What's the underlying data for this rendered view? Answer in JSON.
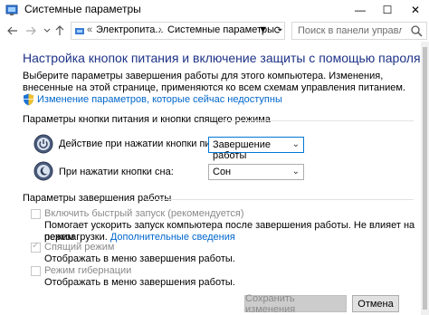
{
  "window": {
    "title": "Системные параметры",
    "controls": {
      "minimize": "—",
      "maximize": "☐",
      "close": "✕"
    }
  },
  "nav": {
    "back_icon": "arrow-left-icon",
    "forward_icon": "arrow-right-icon",
    "up_icon": "arrow-up-icon",
    "breadcrumb_prefix": "«",
    "breadcrumb": [
      "Электропита...",
      "Системные параметры"
    ],
    "breadcrumb_sep": "›",
    "search_placeholder": "Поиск в панели управления"
  },
  "header": {
    "title": "Настройка кнопок питания и включение защиты с помощью пароля",
    "description": "Выберите параметры завершения работы для этого компьютера. Изменения, внесенные на этой странице, применяются ко всем схемам управления питанием.",
    "admin_link": "Изменение параметров, которые сейчас недоступны"
  },
  "power_section": {
    "title": "Параметры кнопки питания и кнопки спящего режима",
    "rows": [
      {
        "label": "Действие при нажатии кнопки питания:",
        "value": "Завершение работы"
      },
      {
        "label": "При нажатии кнопки сна:",
        "value": "Сон"
      }
    ]
  },
  "shutdown_section": {
    "title": "Параметры завершения работы",
    "options": [
      {
        "label": "Включить быстрый запуск (рекомендуется)",
        "checked": false,
        "desc_line1": "Помогает ускорить запуск компьютера после завершения работы. Не влияет на режим",
        "desc_line2": "перезагрузки.",
        "desc_link": "Дополнительные сведения"
      },
      {
        "label": "Спящий режим",
        "checked": true,
        "desc": "Отображать в меню завершения работы."
      },
      {
        "label": "Режим гибернации",
        "checked": false,
        "desc": "Отображать в меню завершения работы."
      }
    ]
  },
  "footer": {
    "save": "Сохранить изменения",
    "cancel": "Отмена"
  }
}
